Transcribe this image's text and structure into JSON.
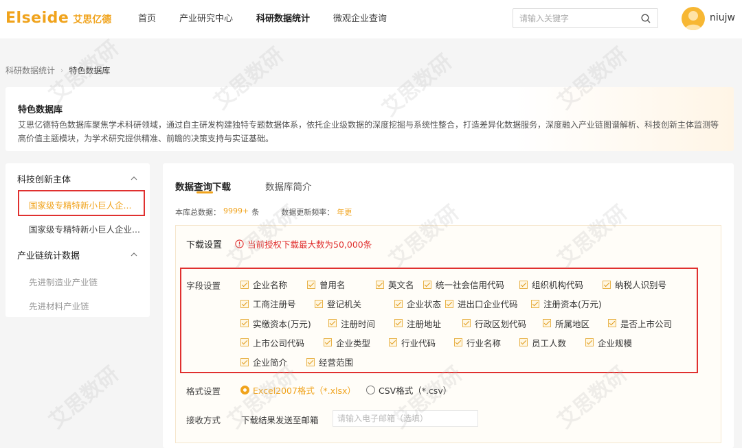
{
  "header": {
    "logo_en": "Elseide",
    "logo_cn": "艾思亿德",
    "nav": [
      "首页",
      "产业研究中心",
      "科研数据统计",
      "微观企业查询"
    ],
    "search_placeholder": "请输入关键字",
    "username": "niujw"
  },
  "breadcrumb": {
    "parent": "科研数据统计",
    "current": "特色数据库"
  },
  "intro": {
    "title": "特色数据库",
    "text": "艾思亿德特色数据库聚焦学术科研领域，通过自主研发构建独特专题数据体系，依托企业级数据的深度挖掘与系统性整合，打造差异化数据服务，深度融入产业链图谱解析、科技创新主体监测等高价值主题模块，为学术研究提供精准、前瞻的决策支持与实证基础。"
  },
  "sidebar": {
    "groups": [
      {
        "label": "科技创新主体",
        "items": [
          "国家级专精特新小巨人企...",
          "国家级专精特新小巨人企业..."
        ]
      },
      {
        "label": "产业链统计数据",
        "items": [
          "先进制造业产业链",
          "先进材料产业链"
        ]
      }
    ]
  },
  "main": {
    "tabs": [
      "数据查询下载",
      "数据库简介"
    ],
    "stats": {
      "total_label": "本库总数据：",
      "total_value": "9999+",
      "total_unit": "条",
      "freq_label": "数据更新频率：",
      "freq_value": "年更"
    },
    "settings_title": "下载设置",
    "warning": "当前授权下载最大数为50,000条",
    "field_label": "字段设置",
    "fields": [
      [
        "企业名称",
        "曾用名",
        "英文名",
        "统一社会信用代码",
        "组织机构代码",
        "纳税人识别号"
      ],
      [
        "工商注册号",
        "登记机关",
        "企业状态",
        "进出口企业代码",
        "注册资本(万元)"
      ],
      [
        "实缴资本(万元)",
        "注册时间",
        "注册地址",
        "行政区划代码",
        "所属地区",
        "是否上市公司"
      ],
      [
        "上市公司代码",
        "企业类型",
        "行业代码",
        "行业名称",
        "员工人数",
        "企业规模"
      ],
      [
        "企业简介",
        "经营范围"
      ]
    ],
    "format_label": "格式设置",
    "format_options": [
      {
        "label": "Excel2007格式（*.xlsx）",
        "selected": true
      },
      {
        "label": "CSV格式（*.csv）",
        "selected": false
      }
    ],
    "receive_label": "接收方式",
    "receive_text": "下载结果发送至邮箱",
    "email_placeholder": "请输入电子邮箱（选填）"
  },
  "watermark": "艾思数研",
  "colors": {
    "accent": "#f0a31c",
    "highlight": "#e0302f"
  }
}
